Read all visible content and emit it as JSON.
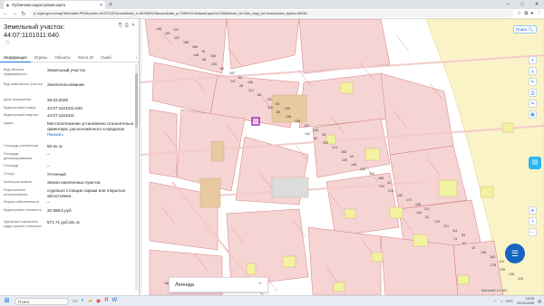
{
  "browser": {
    "tab_title": "Публичная кадастровая карта",
    "url": "nspd.gov.ru/map?thematic=PKK&zoom=18.072137&coordinate_x=4678953.0&coordinate_y=7395193.0&baseLayerId=235&theme_id=1&is_copy_url=true&active_layers=36048",
    "window_controls": [
      "–",
      "□",
      "✕"
    ]
  },
  "panel": {
    "title": "Земельный участок: 44:07:1101011:640",
    "tabs": [
      "Информация",
      "Отрезы",
      "Объекты",
      "Части ЗУ",
      "Ошиб"
    ],
    "rows": [
      {
        "label": "Вид объекта недвижимости",
        "value": "Земельный участок"
      },
      {
        "label": "Вид земельного участка",
        "value": "Землепользование"
      },
      {
        "label": "Дата присвоения",
        "value": "26.03.2025"
      },
      {
        "label": "Кадастровый номер",
        "value": "44:07:1101011:640"
      },
      {
        "label": "Кадастровый квартал",
        "value": "44:07:1101011"
      },
      {
        "label": "Адрес",
        "value": "Местоположение установлено относительно ориентира, расположенного в пределах",
        "link": "Показать"
      },
      {
        "label": "Площадь уточненная",
        "value": "50 кв. м"
      },
      {
        "label": "Площадь декларированная",
        "value": "–"
      },
      {
        "label": "Площадь",
        "value": "–"
      },
      {
        "label": "Статус",
        "value": "Учтенный"
      },
      {
        "label": "Категория земель",
        "value": "Земли населенных пунктов"
      },
      {
        "label": "Разрешенное использование",
        "value": "отдельно стоящие гаражи или открытые автостоянки"
      },
      {
        "label": "Форма собственности",
        "value": "–"
      },
      {
        "label": "Кадастровая стоимость",
        "value": "20 588,5 руб."
      },
      {
        "label": "Удельный показатель кадастровой стоимости",
        "value": "571,71 руб./кв. м"
      }
    ]
  },
  "map": {
    "search_button": "Поиск",
    "legend_label": "Легенда",
    "scale_text": "Масштаб 1:2 000",
    "parcel_numbers": [
      "140",
      "148",
      "147",
      "115",
      "142",
      "139",
      "141",
      "140",
      "74",
      "178",
      "201",
      "48",
      "28",
      "60",
      "83",
      "148",
      "210",
      "32",
      "57",
      "135",
      "131",
      "153",
      "112",
      "138",
      "123",
      "134",
      "132",
      "175",
      "15",
      "126",
      "188",
      "80",
      "68",
      "139",
      "113",
      "113",
      "172",
      "121",
      "128",
      "123",
      "169",
      "197",
      "131",
      "137",
      "185",
      "188",
      "138",
      "111",
      "183",
      "162",
      "76",
      "51",
      "63",
      "126",
      "63",
      "41",
      "112",
      "53",
      "119",
      "137",
      "166",
      "106",
      "100",
      "28"
    ]
  },
  "taskbar": {
    "search_placeholder": "Поиск",
    "time": "14:05",
    "date": "25.04.2025",
    "lang": "РУС"
  },
  "colors": {
    "parcel_fill": "#f6d4d4",
    "parcel_stroke": "#d37a7a",
    "building": "#f2f2a0",
    "selected": "#9c27b0",
    "zone": "#fbf3c8",
    "accent": "#1976d2"
  }
}
